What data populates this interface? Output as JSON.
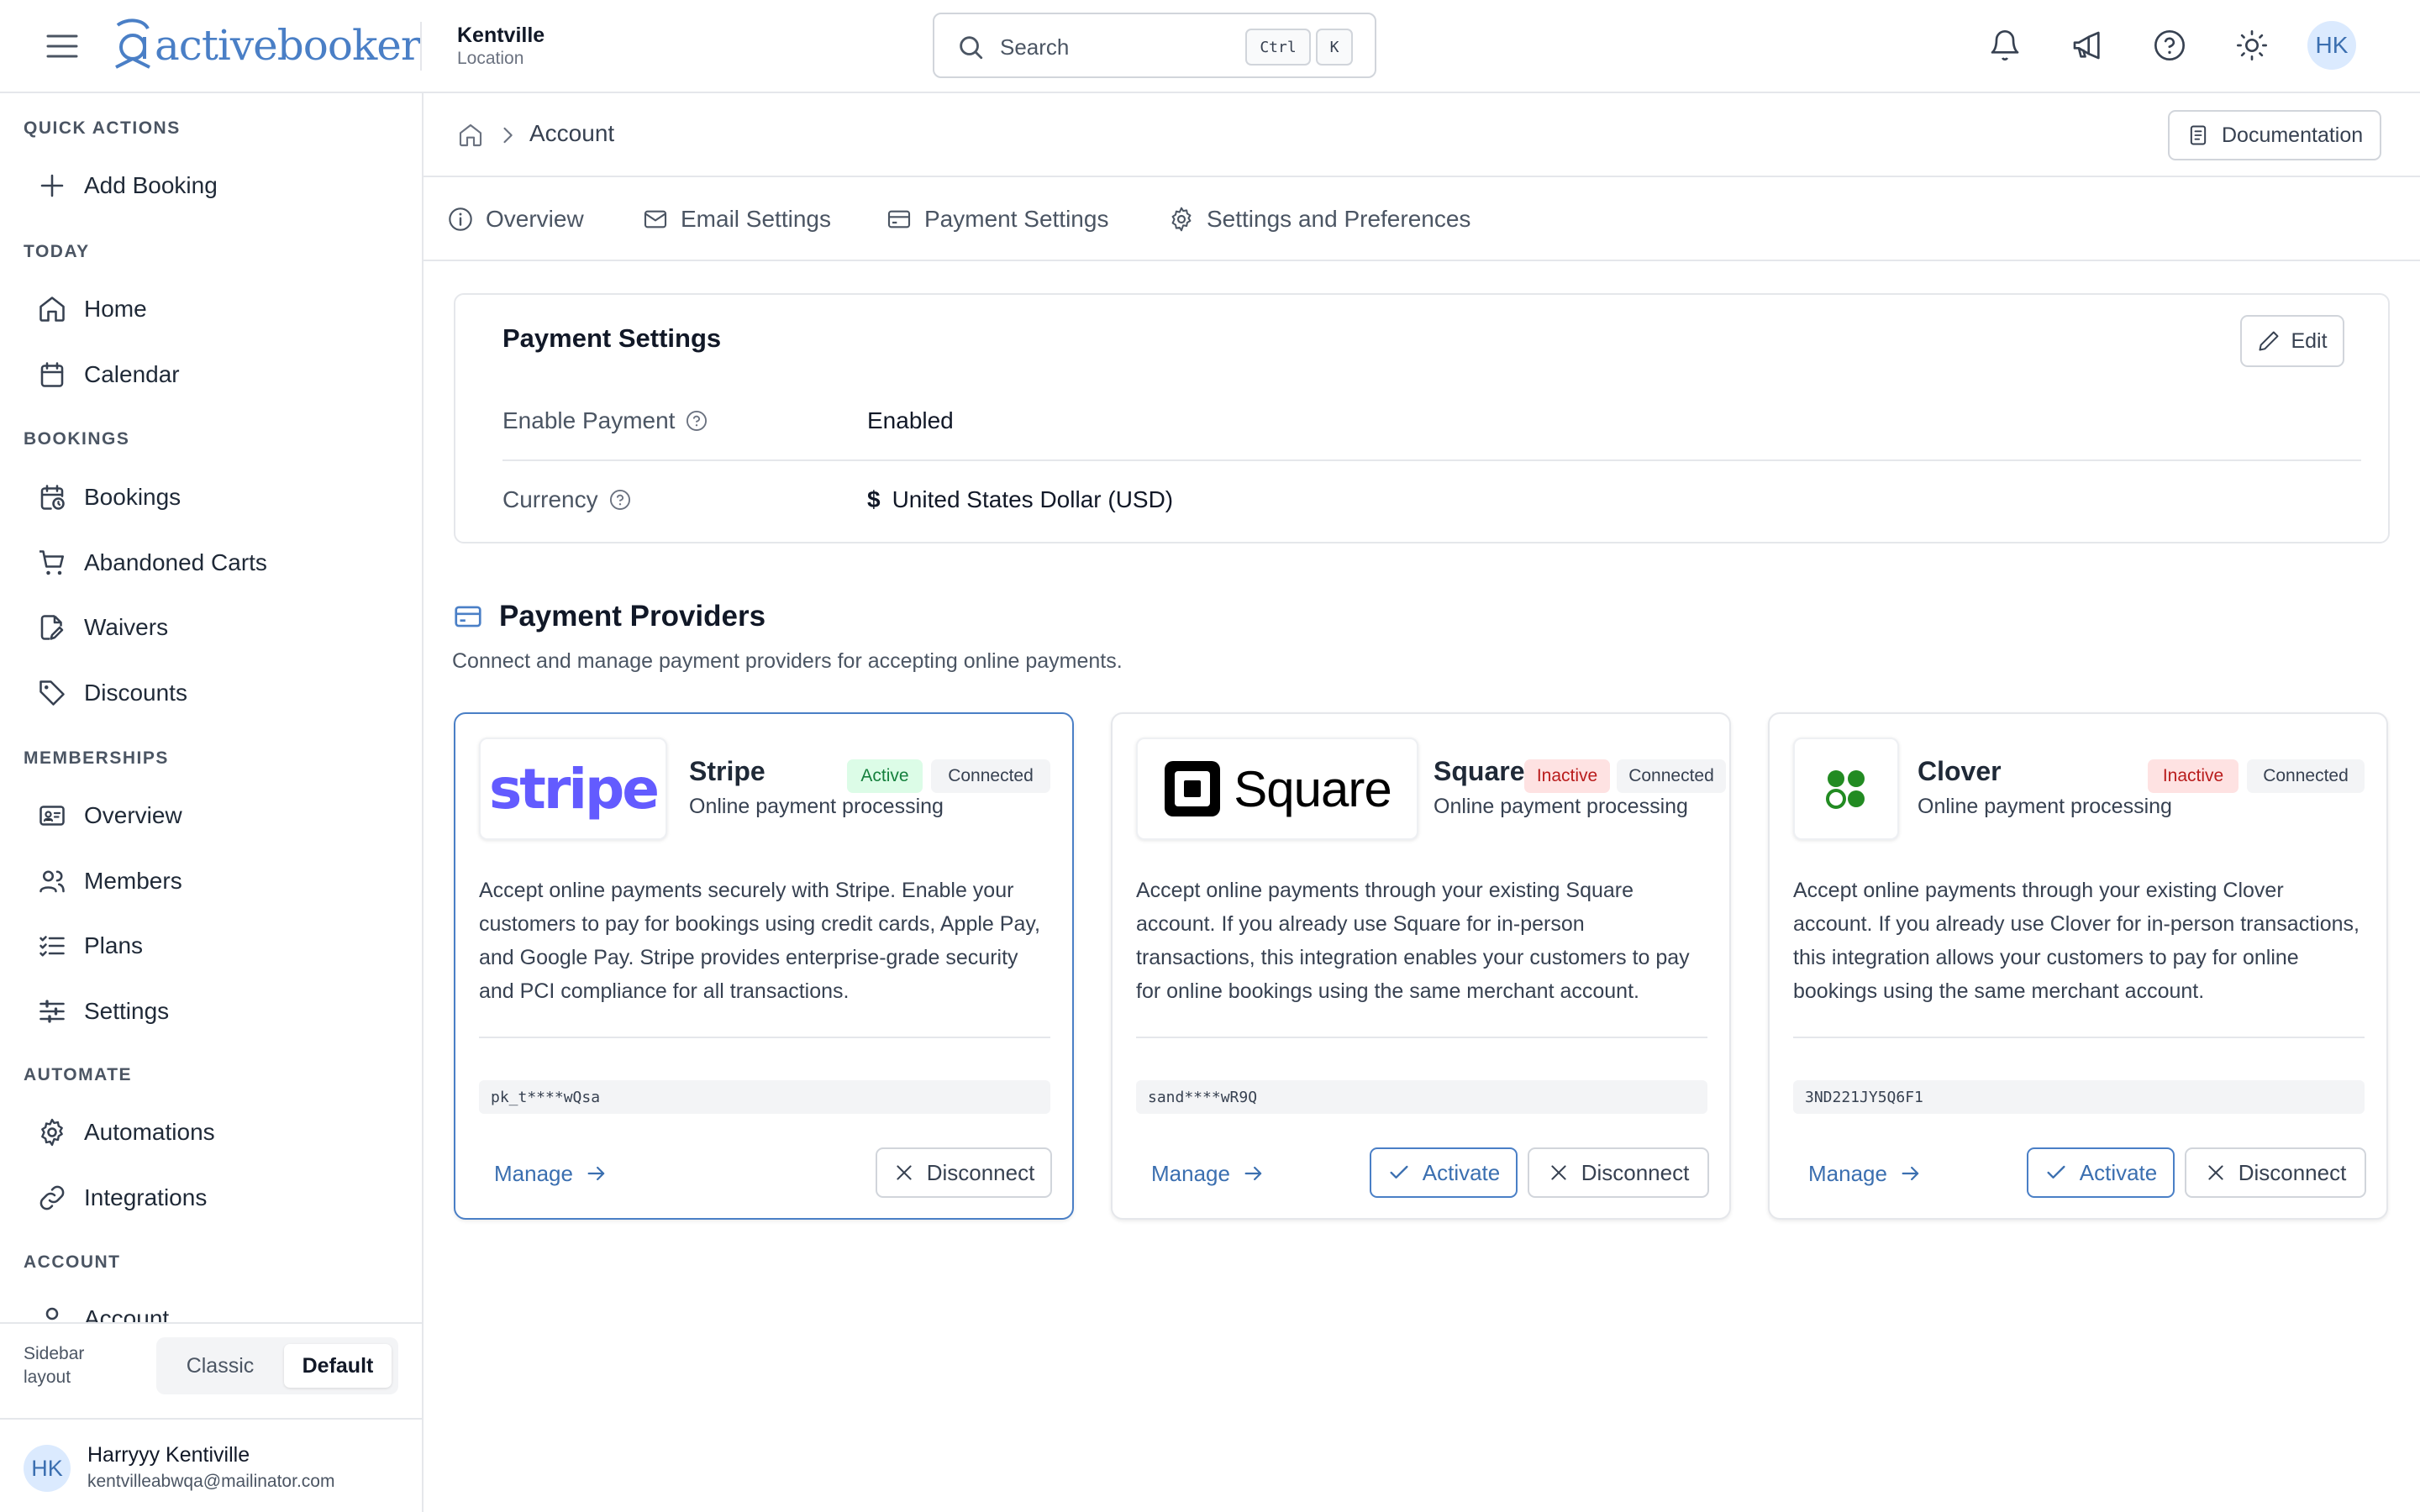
{
  "header": {
    "logo_text": "activebooker",
    "location_name": "Kentville",
    "location_sub": "Location",
    "search_placeholder": "Search",
    "shortcut_ctrl": "Ctrl",
    "shortcut_k": "K",
    "user_initials": "HK"
  },
  "sidebar": {
    "sections": [
      {
        "title": "QUICK ACTIONS",
        "items": [
          {
            "label": "Add Booking",
            "icon": "plus-icon"
          }
        ]
      },
      {
        "title": "TODAY",
        "items": [
          {
            "label": "Home",
            "icon": "home-icon"
          },
          {
            "label": "Calendar",
            "icon": "calendar-icon"
          }
        ]
      },
      {
        "title": "BOOKINGS",
        "items": [
          {
            "label": "Bookings",
            "icon": "calendar-clock-icon"
          },
          {
            "label": "Abandoned Carts",
            "icon": "cart-icon"
          },
          {
            "label": "Waivers",
            "icon": "file-signature-icon"
          },
          {
            "label": "Discounts",
            "icon": "tag-icon"
          }
        ]
      },
      {
        "title": "MEMBERSHIPS",
        "items": [
          {
            "label": "Overview",
            "icon": "id-card-icon"
          },
          {
            "label": "Members",
            "icon": "users-icon"
          },
          {
            "label": "Plans",
            "icon": "list-checks-icon"
          },
          {
            "label": "Settings",
            "icon": "sliders-icon"
          }
        ]
      },
      {
        "title": "AUTOMATE",
        "items": [
          {
            "label": "Automations",
            "icon": "gear-icon"
          },
          {
            "label": "Integrations",
            "icon": "link-icon"
          }
        ]
      },
      {
        "title": "ACCOUNT",
        "items": [
          {
            "label": "Account",
            "icon": "user-icon"
          }
        ]
      }
    ],
    "layout_label": "Sidebar layout",
    "layout_options": [
      "Classic",
      "Default"
    ],
    "layout_selected": "Default",
    "user_initials": "HK",
    "user_name": "Harryyy Kentiville",
    "user_email": "kentvilleabwqa@mailinator.com"
  },
  "breadcrumb": {
    "current": "Account"
  },
  "documentation_label": "Documentation",
  "tabs": [
    {
      "label": "Overview",
      "icon": "info-icon"
    },
    {
      "label": "Email Settings",
      "icon": "mail-icon"
    },
    {
      "label": "Payment Settings",
      "icon": "credit-card-icon"
    },
    {
      "label": "Settings and Preferences",
      "icon": "gear-icon"
    }
  ],
  "payment_settings": {
    "title": "Payment Settings",
    "edit_label": "Edit",
    "rows": [
      {
        "label": "Enable Payment",
        "value": "Enabled"
      },
      {
        "label": "Currency",
        "value_symbol": "$",
        "value": "United States Dollar (USD)"
      }
    ]
  },
  "providers": {
    "title": "Payment Providers",
    "subtitle": "Connect and manage payment providers for accepting online payments.",
    "cards": [
      {
        "name": "Stripe",
        "logo_text": "stripe",
        "tagline": "Online payment processing",
        "status": "Active",
        "connection": "Connected",
        "description": "Accept online payments securely with Stripe. Enable your customers to pay for bookings using credit cards, Apple Pay, and Google Pay. Stripe provides enterprise-grade security and PCI compliance for all transactions.",
        "key": "pk_t****wQsa",
        "manage_label": "Manage",
        "disconnect_label": "Disconnect"
      },
      {
        "name": "Square",
        "logo_text": "Square",
        "tagline": "Online payment processing",
        "status": "Inactive",
        "connection": "Connected",
        "description": "Accept online payments through your existing Square account. If you already use Square for in-person transactions, this integration enables your customers to pay for online bookings using the same merchant account.",
        "key": "sand****wR9Q",
        "manage_label": "Manage",
        "activate_label": "Activate",
        "disconnect_label": "Disconnect"
      },
      {
        "name": "Clover",
        "tagline": "Online payment processing",
        "status": "Inactive",
        "connection": "Connected",
        "description": "Accept online payments through your existing Clover account. If you already use Clover for in-person transactions, this integration allows your customers to pay for online bookings using the same merchant account.",
        "key": "3ND221JY5Q6F1",
        "manage_label": "Manage",
        "activate_label": "Activate",
        "disconnect_label": "Disconnect"
      }
    ]
  },
  "colors": {
    "brand": "#4a7fc6",
    "stripe": "#635bff",
    "clover": "#228b22",
    "active_badge": "#15803d",
    "inactive_badge": "#b91c1c"
  }
}
